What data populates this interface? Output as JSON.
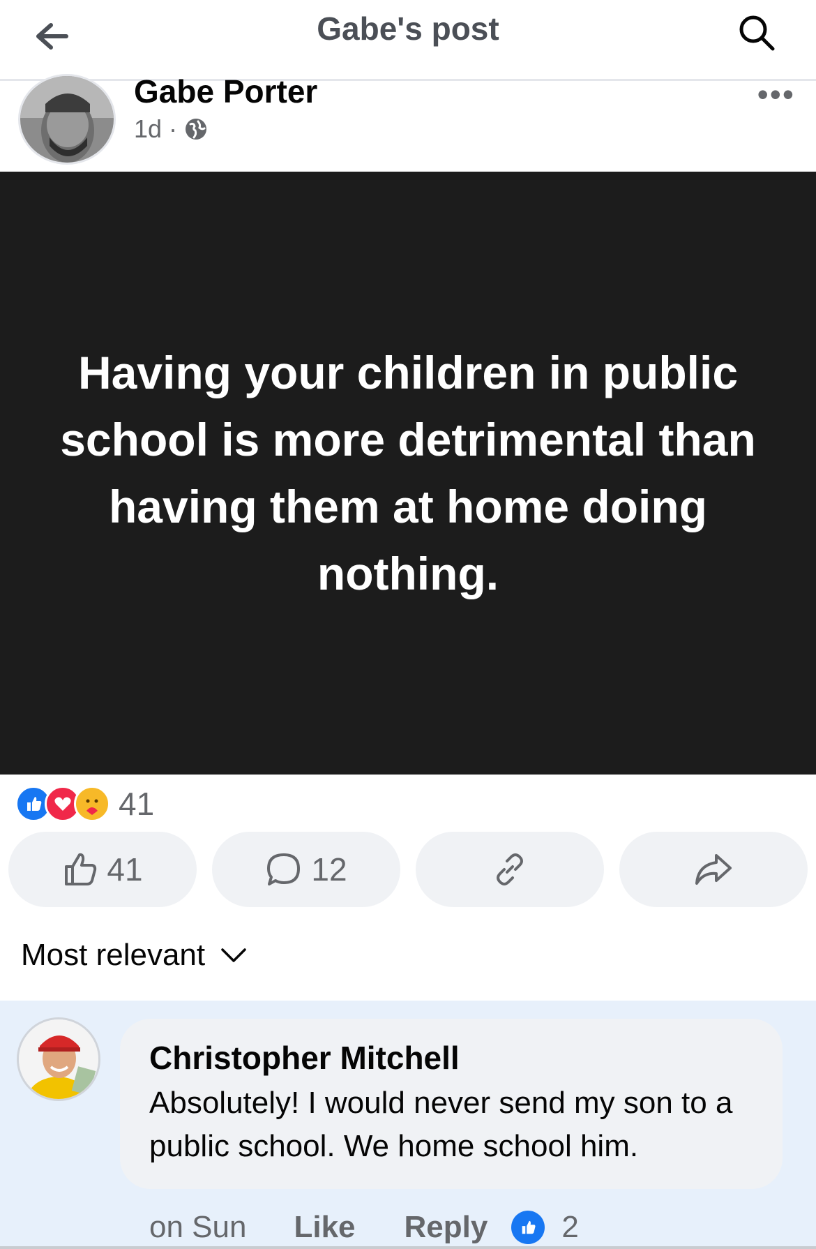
{
  "topbar": {
    "title": "Gabe's post",
    "back_icon": "arrow-left-icon",
    "search_icon": "search-icon"
  },
  "post": {
    "author": "Gabe Porter",
    "time": "1d",
    "separator": "·",
    "privacy_icon": "globe-icon",
    "more_label": "•••",
    "text": "Having your children in public school is more detrimental than having them at home doing nothing.",
    "reactions": {
      "icons": [
        "like-icon",
        "love-icon",
        "care-icon"
      ],
      "count": "41"
    },
    "actions": {
      "like_count": "41",
      "comment_count": "12",
      "link_icon": "link-icon",
      "share_icon": "share-icon"
    }
  },
  "comments": {
    "sort_label": "Most relevant",
    "items": [
      {
        "author": "Christopher Mitchell",
        "text": "Absolutely! I would never send my son to a public school. We home school him.",
        "time": "on Sun",
        "like_label": "Like",
        "reply_label": "Reply",
        "like_count": "2"
      }
    ]
  },
  "colors": {
    "accent": "#1877f2",
    "love": "#f02849",
    "care": "#f7b928",
    "image_bg": "#1c1c1c",
    "comment_highlight": "#e7f0fb"
  }
}
